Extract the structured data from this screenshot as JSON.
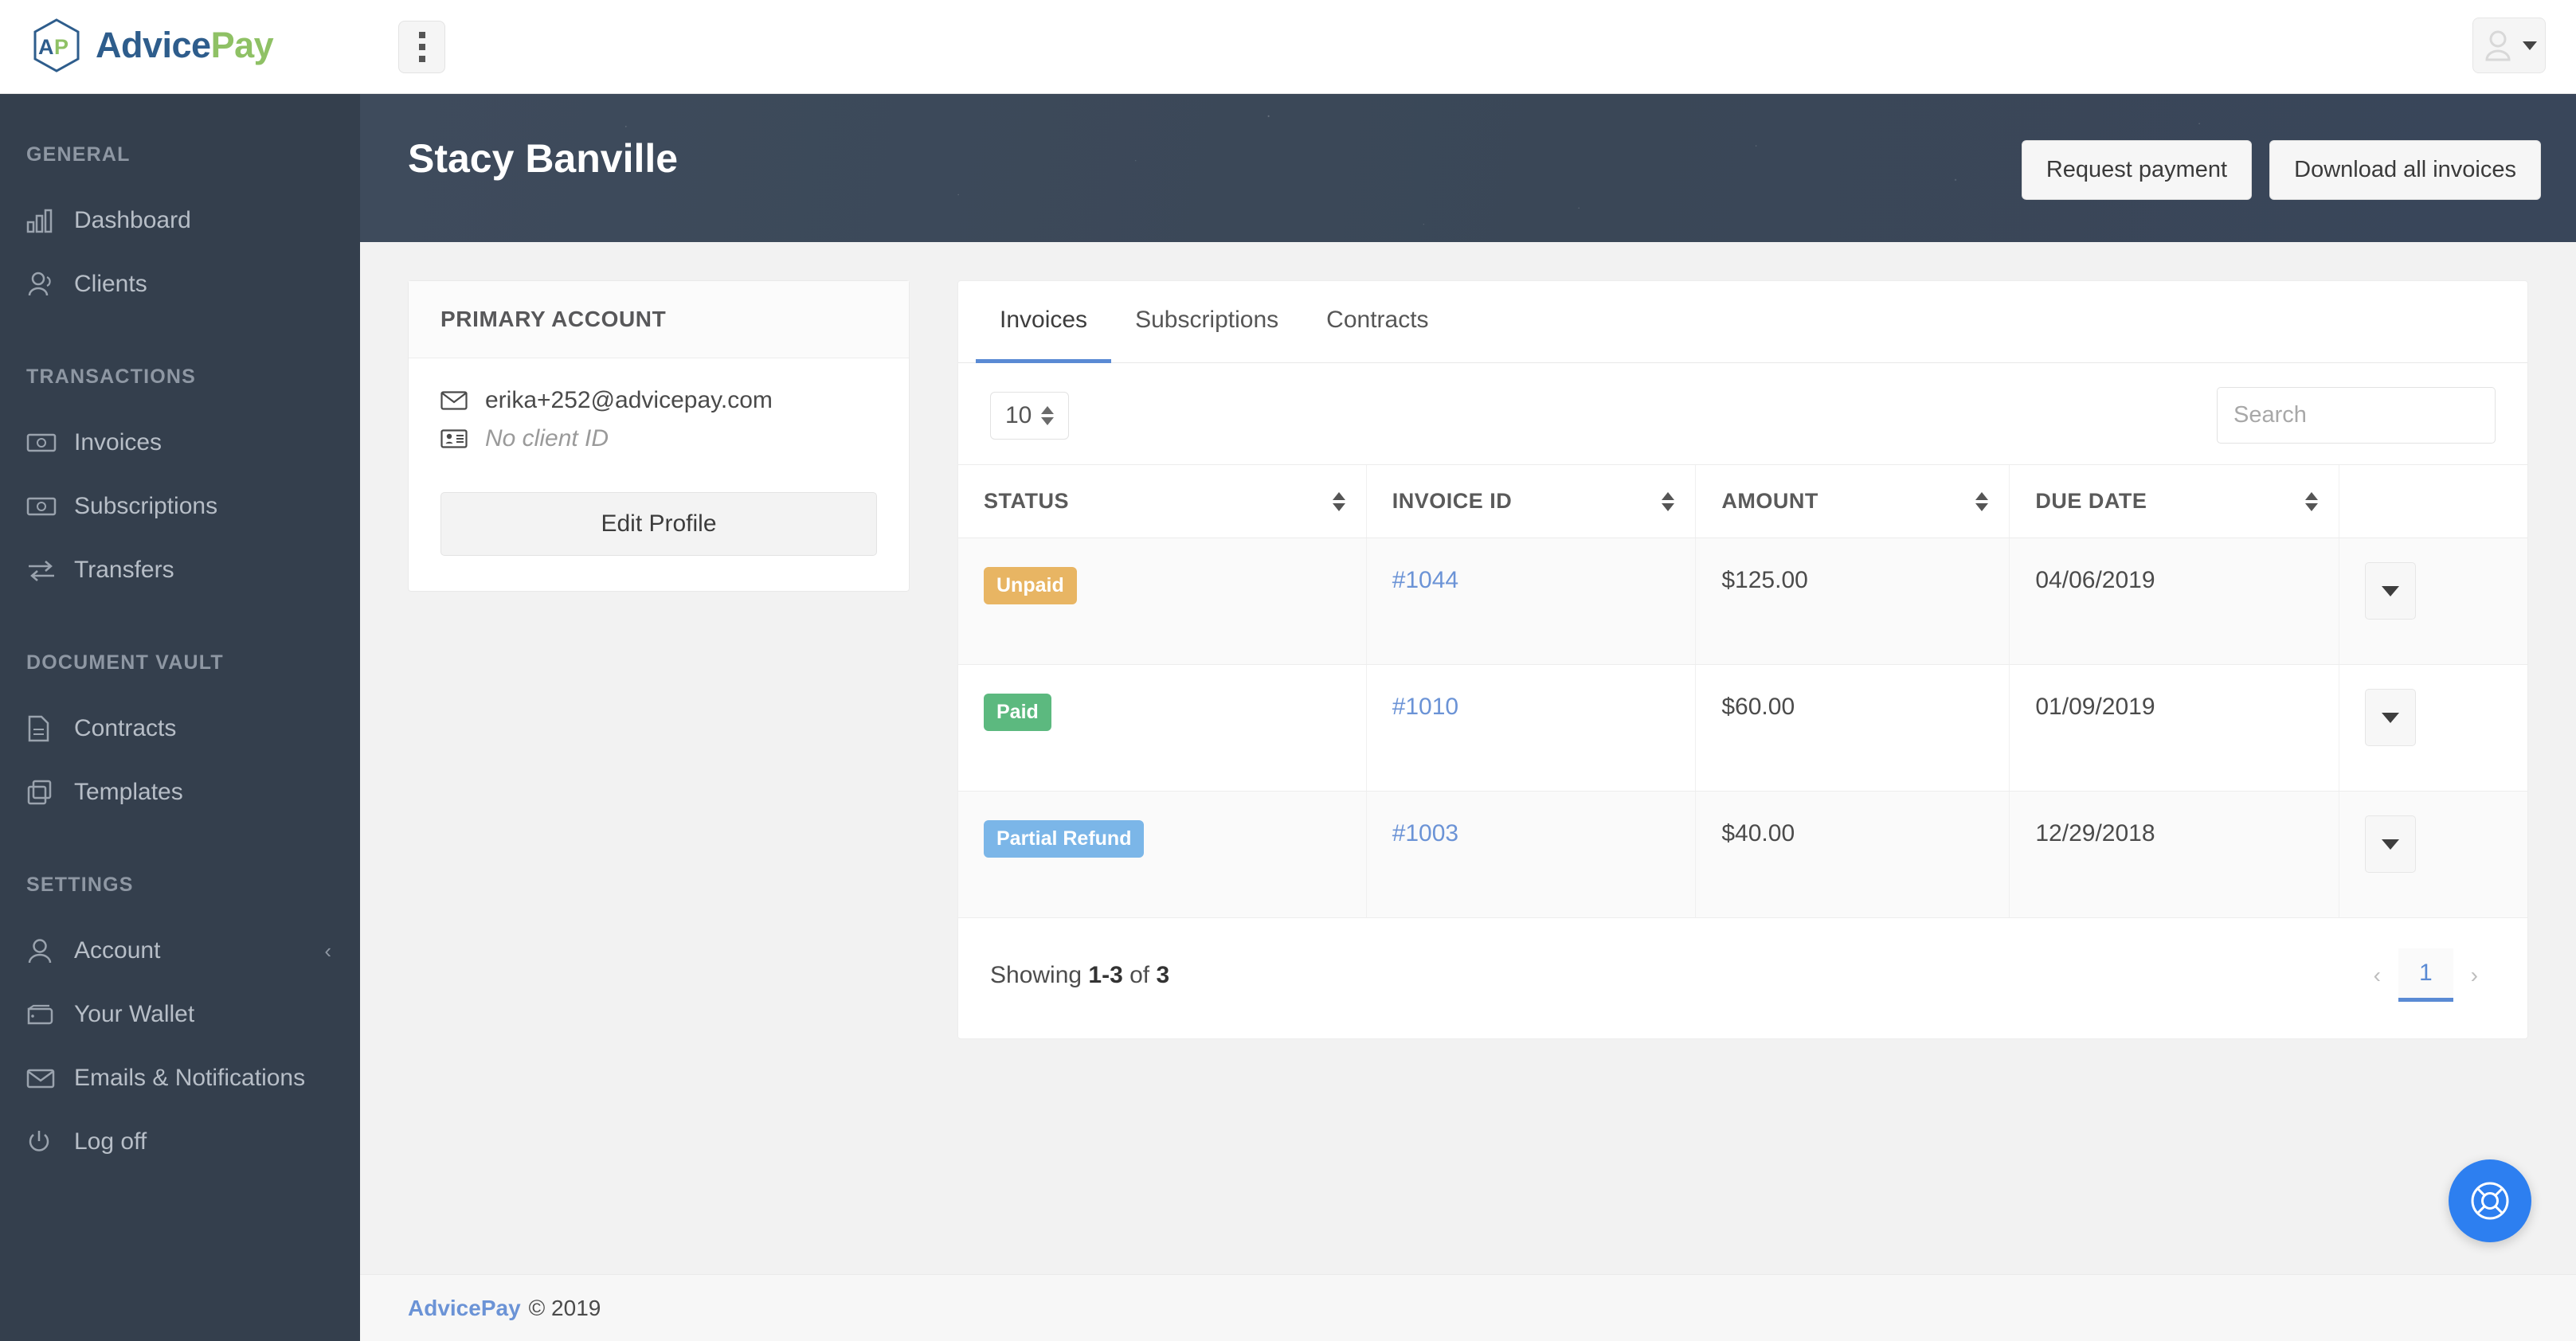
{
  "brand": {
    "name_part1": "Advice",
    "name_part2": "Pay",
    "color_primary": "#2e5d8c",
    "color_accent": "#8fc165"
  },
  "topbar": {
    "menu_label": "",
    "user_menu_label": ""
  },
  "sidebar": {
    "sections": [
      {
        "title": "GENERAL",
        "items": [
          {
            "label": "Dashboard",
            "icon": "chart-bar-icon"
          },
          {
            "label": "Clients",
            "icon": "users-icon"
          }
        ]
      },
      {
        "title": "TRANSACTIONS",
        "items": [
          {
            "label": "Invoices",
            "icon": "money-bill-icon"
          },
          {
            "label": "Subscriptions",
            "icon": "money-bill-icon"
          },
          {
            "label": "Transfers",
            "icon": "exchange-arrows-icon"
          }
        ]
      },
      {
        "title": "DOCUMENT VAULT",
        "items": [
          {
            "label": "Contracts",
            "icon": "file-text-icon"
          },
          {
            "label": "Templates",
            "icon": "copy-icon"
          }
        ]
      },
      {
        "title": "SETTINGS",
        "items": [
          {
            "label": "Account",
            "icon": "user-icon",
            "chevron": "‹"
          },
          {
            "label": "Your Wallet",
            "icon": "wallet-icon"
          },
          {
            "label": "Emails & Notifications",
            "icon": "envelope-icon"
          },
          {
            "label": "Log off",
            "icon": "power-icon"
          }
        ]
      }
    ]
  },
  "header": {
    "title": "Stacy Banville",
    "request_payment_label": "Request payment",
    "download_all_label": "Download all invoices"
  },
  "account_card": {
    "heading": "PRIMARY ACCOUNT",
    "email": "erika+252@advicepay.com",
    "client_id": "No client ID",
    "edit_profile_label": "Edit Profile"
  },
  "panel": {
    "tabs": [
      {
        "label": "Invoices",
        "active": true
      },
      {
        "label": "Subscriptions",
        "active": false
      },
      {
        "label": "Contracts",
        "active": false
      }
    ],
    "page_size": "10",
    "search_placeholder": "Search",
    "search_value": "",
    "columns": [
      "STATUS",
      "INVOICE ID",
      "AMOUNT",
      "DUE DATE"
    ],
    "rows": [
      {
        "status": "Unpaid",
        "status_color": "#e8b563",
        "invoice_id": "#1044",
        "amount": "$125.00",
        "due_date": "04/06/2019"
      },
      {
        "status": "Paid",
        "status_color": "#5cb97f",
        "invoice_id": "#1010",
        "amount": "$60.00",
        "due_date": "01/09/2019"
      },
      {
        "status": "Partial Refund",
        "status_color": "#7bb6e8",
        "invoice_id": "#1003",
        "amount": "$40.00",
        "due_date": "12/29/2018"
      }
    ],
    "showing_prefix": "Showing ",
    "showing_range": "1-3",
    "showing_middle": " of ",
    "showing_total": "3",
    "pagination": {
      "prev": "‹",
      "current": "1",
      "next": "›"
    }
  },
  "footer": {
    "brand": "AdvicePay",
    "copyright": "© 2019"
  },
  "help": {
    "label": "support"
  }
}
